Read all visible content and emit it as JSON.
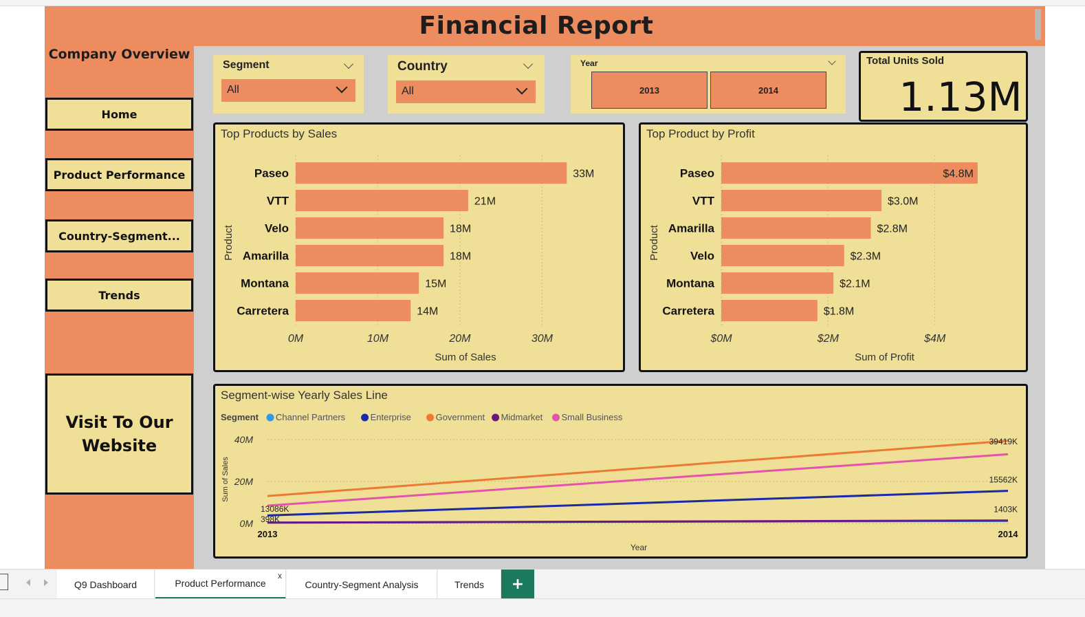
{
  "report": {
    "title": "Financial Report"
  },
  "sidebar": {
    "company_label": "Company Overview",
    "nav": [
      {
        "label": "Home"
      },
      {
        "label": "Product Performance"
      },
      {
        "label": "Country-Segment..."
      },
      {
        "label": "Trends"
      }
    ],
    "website_label": "Visit To Our Website"
  },
  "filters": {
    "segment": {
      "label": "Segment",
      "value": "All"
    },
    "country": {
      "label": "Country",
      "value": "All"
    },
    "year": {
      "label": "Year",
      "options": [
        "2013",
        "2014"
      ]
    }
  },
  "kpi": {
    "title": "Total Units Sold",
    "value": "1.13M"
  },
  "colors": {
    "page_bg": "#cfcfcf",
    "accent_orange": "#ec8c5f",
    "card_yellow": "#f0df96",
    "bar_fill": "#ec8c5f",
    "tab_green": "#1b7a5d"
  },
  "chart_data": [
    {
      "type": "bar",
      "orientation": "horizontal",
      "title": "Top Products by Sales",
      "ylabel": "Product",
      "xlabel": "Sum of Sales",
      "categories": [
        "Paseo",
        "VTT",
        "Velo",
        "Amarilla",
        "Montana",
        "Carretera"
      ],
      "values": [
        33,
        21,
        18,
        18,
        15,
        14
      ],
      "data_labels": [
        "33M",
        "21M",
        "18M",
        "18M",
        "15M",
        "14M"
      ],
      "xticks": [
        0,
        10,
        20,
        30
      ],
      "xtick_labels": [
        "0M",
        "10M",
        "20M",
        "30M"
      ],
      "xlim": [
        0,
        38
      ],
      "grid": true
    },
    {
      "type": "bar",
      "orientation": "horizontal",
      "title": "Top Product by Profit",
      "ylabel": "Product",
      "xlabel": "Sum of Profit",
      "categories": [
        "Paseo",
        "VTT",
        "Amarilla",
        "Velo",
        "Montana",
        "Carretera"
      ],
      "values": [
        4.8,
        3.0,
        2.8,
        2.3,
        2.1,
        1.8
      ],
      "data_labels": [
        "$4.8M",
        "$3.0M",
        "$2.8M",
        "$2.3M",
        "$2.1M",
        "$1.8M"
      ],
      "xticks": [
        0,
        2,
        4
      ],
      "xtick_labels": [
        "$0M",
        "$2M",
        "$4M"
      ],
      "xlim": [
        0,
        5.6
      ],
      "grid": true
    },
    {
      "type": "line",
      "title": "Segment-wise Yearly Sales Line",
      "legend_title": "Segment",
      "legend_position": "top-left",
      "xlabel": "Year",
      "ylabel": "Sum of Sales",
      "x": [
        "2013",
        "2014"
      ],
      "yticks": [
        0,
        20,
        40
      ],
      "ytick_labels": [
        "0M",
        "20M",
        "40M"
      ],
      "ylim": [
        0,
        42
      ],
      "grid": true,
      "series": [
        {
          "name": "Channel Partners",
          "color": "#2f9ae8",
          "values": [
            0.4,
            1.2
          ]
        },
        {
          "name": "Enterprise",
          "color": "#1b2aa8",
          "values": [
            3.8,
            15.562
          ]
        },
        {
          "name": "Government",
          "color": "#ec7a35",
          "values": [
            13.086,
            39.419
          ]
        },
        {
          "name": "Midmarket",
          "color": "#6a1780",
          "values": [
            0.398,
            1.403
          ]
        },
        {
          "name": "Small Business",
          "color": "#e454ae",
          "values": [
            8.5,
            33.0
          ]
        }
      ],
      "annotations": [
        "13086K",
        "398K",
        "39419K",
        "15562K",
        "1403K"
      ]
    }
  ],
  "tabs": {
    "items": [
      {
        "label": "Q9 Dashboard"
      },
      {
        "label": "Product Performance"
      },
      {
        "label": "Country-Segment Analysis"
      },
      {
        "label": "Trends"
      }
    ],
    "close_glyph": "x",
    "add_glyph": "+"
  }
}
